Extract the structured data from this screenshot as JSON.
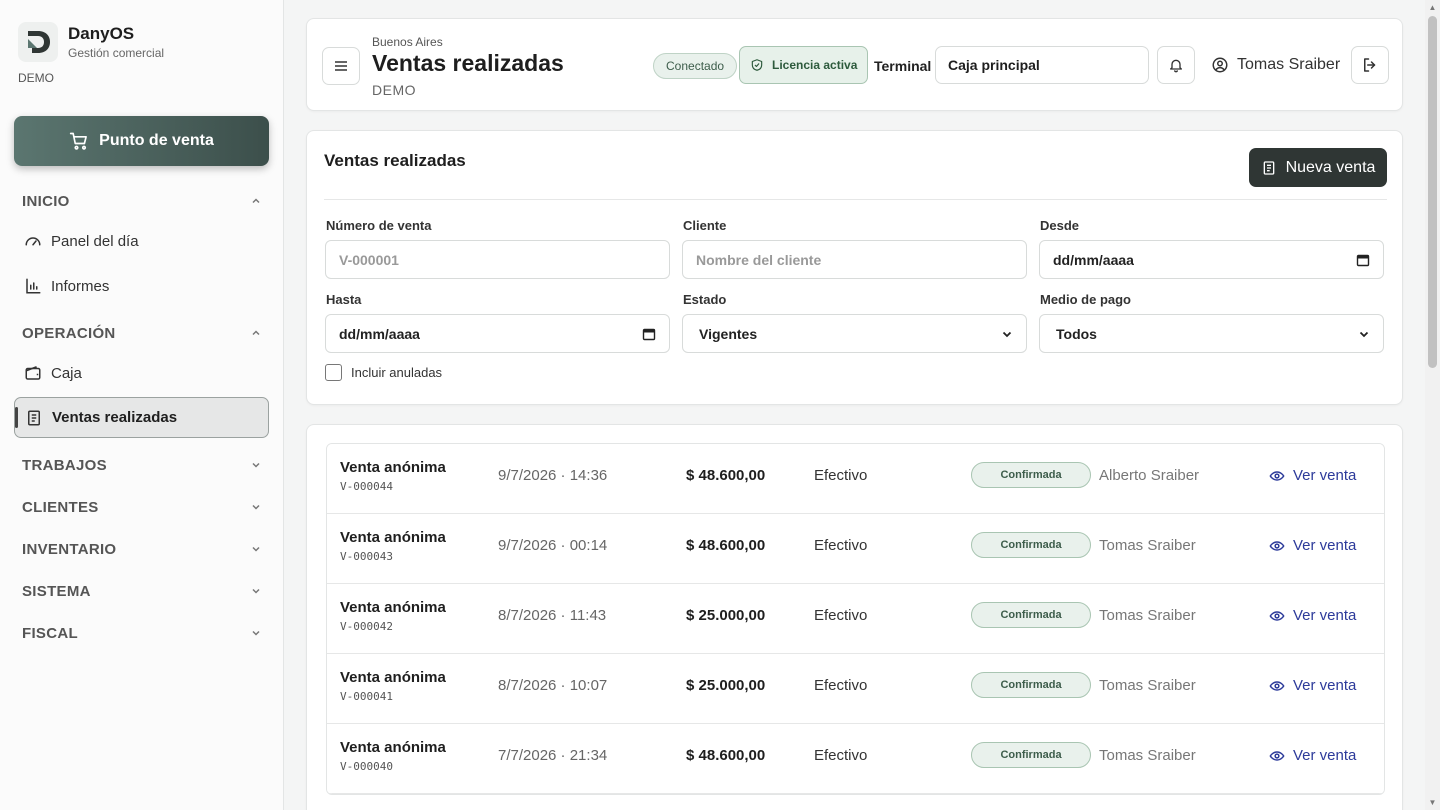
{
  "brand": {
    "name": "DanyOS",
    "subtitle": "Gestión comercial",
    "env": "DEMO"
  },
  "sidebar": {
    "pos_button": "Punto de venta",
    "sections": [
      {
        "label": "INICIO",
        "items": [
          "Panel del día",
          "Informes"
        ]
      },
      {
        "label": "OPERACIÓN",
        "items": [
          "Caja",
          "Ventas realizadas"
        ]
      },
      {
        "label": "TRABAJOS"
      },
      {
        "label": "CLIENTES"
      },
      {
        "label": "INVENTARIO"
      },
      {
        "label": "SISTEMA"
      },
      {
        "label": "FISCAL"
      }
    ]
  },
  "header": {
    "city": "Buenos Aires",
    "title": "Ventas realizadas",
    "env": "DEMO",
    "connected": "Conectado",
    "license": "Licencia activa",
    "terminal_label": "Terminal",
    "terminal_value": "Caja principal",
    "user": "Tomas Sraiber"
  },
  "filters": {
    "title": "Ventas realizadas",
    "new_sale": "Nueva venta",
    "sale_number": {
      "label": "Número de venta",
      "placeholder": "V-000001"
    },
    "client": {
      "label": "Cliente",
      "placeholder": "Nombre del cliente"
    },
    "from": {
      "label": "Desde",
      "value": "dd/mm/aaaa"
    },
    "to": {
      "label": "Hasta",
      "value": "dd/mm/aaaa"
    },
    "status": {
      "label": "Estado",
      "value": "Vigentes"
    },
    "payment": {
      "label": "Medio de pago",
      "value": "Todos"
    },
    "include_cancelled": "Incluir anuladas"
  },
  "sales": {
    "view_label": "Ver venta",
    "rows": [
      {
        "title": "Venta anónima",
        "number": "V-000044",
        "date": "9/7/2026 · 14:36",
        "amount": "$ 48.600,00",
        "method": "Efectivo",
        "status": "Confirmada",
        "user": "Alberto Sraiber"
      },
      {
        "title": "Venta anónima",
        "number": "V-000043",
        "date": "9/7/2026 · 00:14",
        "amount": "$ 48.600,00",
        "method": "Efectivo",
        "status": "Confirmada",
        "user": "Tomas Sraiber"
      },
      {
        "title": "Venta anónima",
        "number": "V-000042",
        "date": "8/7/2026 · 11:43",
        "amount": "$ 25.000,00",
        "method": "Efectivo",
        "status": "Confirmada",
        "user": "Tomas Sraiber"
      },
      {
        "title": "Venta anónima",
        "number": "V-000041",
        "date": "8/7/2026 · 10:07",
        "amount": "$ 25.000,00",
        "method": "Efectivo",
        "status": "Confirmada",
        "user": "Tomas Sraiber"
      },
      {
        "title": "Venta anónima",
        "number": "V-000040",
        "date": "7/7/2026 · 21:34",
        "amount": "$ 48.600,00",
        "method": "Efectivo",
        "status": "Confirmada",
        "user": "Tomas Sraiber"
      }
    ]
  },
  "colors": {
    "accent": "#3c4f4b",
    "primary_dark": "#2f3634",
    "success_bg": "#e9f1ec",
    "link": "#2c3a9a"
  }
}
